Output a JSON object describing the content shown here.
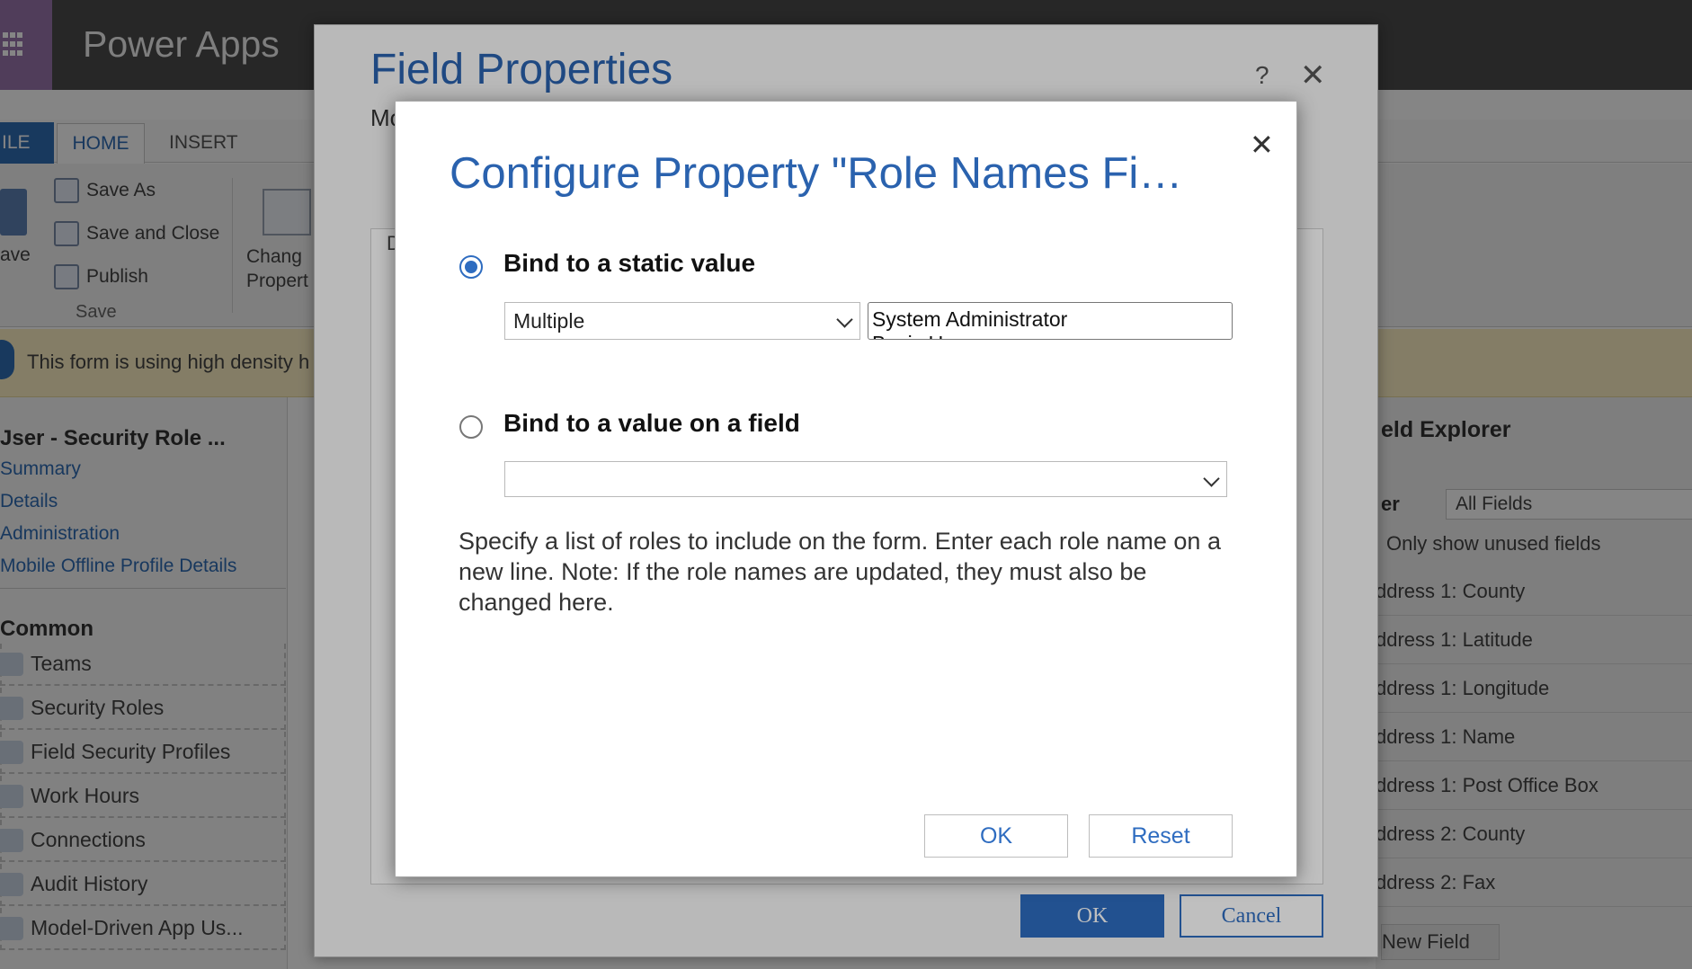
{
  "app": {
    "title": "Power Apps",
    "ribbon": {
      "tabs": [
        "ILE",
        "HOME",
        "INSERT"
      ],
      "save_as": "Save As",
      "save_and_close": "Save and Close",
      "publish": "Publish",
      "save_big": "ave",
      "save_group": "Save",
      "change_properties": "Chang\nPropert"
    },
    "notice": "This form is using high density h",
    "left_nav": {
      "title": "Jser - Security Role ...",
      "links": [
        "Summary",
        "Details",
        "Administration",
        "Mobile Offline Profile Details"
      ],
      "common_header": "Common",
      "common_items": [
        "Teams",
        "Security Roles",
        "Field Security Profiles",
        "Work Hours",
        "Connections",
        "Audit History",
        "Model-Driven App Us..."
      ]
    },
    "field_explorer": {
      "title": "eld Explorer",
      "filter_label": "er",
      "filter_value": "All Fields",
      "unused_only": "Only show unused fields",
      "fields": [
        "ddress 1: County",
        "ddress 1: Latitude",
        "ddress 1: Longitude",
        "ddress 1: Name",
        "ddress 1: Post Office Box",
        "ddress 2: County",
        "ddress 2: Fax"
      ],
      "new_field": "New Field"
    }
  },
  "field_properties": {
    "title": "Field Properties",
    "subtitle": "Mo",
    "help": "?",
    "close": "✕",
    "inner_tab": "D",
    "ok": "OK",
    "cancel": "Cancel"
  },
  "configure_property": {
    "title": "Configure Property \"Role Names Fi…",
    "close": "✕",
    "option_static": {
      "label": "Bind to a static value",
      "selected": true,
      "type_value": "Multiple",
      "values_text": "System Administrator\nBasic U"
    },
    "option_field": {
      "label": "Bind to a value on a field",
      "selected": false,
      "field_value": ""
    },
    "description": "Specify a list of roles to include on the form. Enter each role name on a new line. Note: If the role names are updated, they must also be changed here.",
    "ok": "OK",
    "reset": "Reset"
  },
  "colors": {
    "accent": "#2e6cc0",
    "title_blue": "#2a62ae",
    "topbar": "#4b4b4b",
    "waffle": "#9a76ad"
  }
}
